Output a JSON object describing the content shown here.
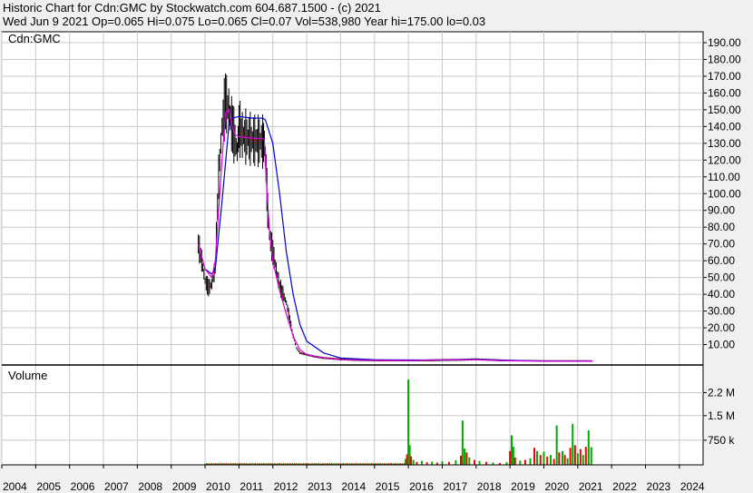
{
  "header": {
    "line1": "Historic Chart for Cdn:GMC by Stockwatch.com 604.687.1500 - (c) 2021",
    "line2": "Wed Jun  9 2021   Op=0.065  Hi=0.075   Lo=0.065   Cl=0.07   Vol=538,980   Year hi=175.00   lo=0.03"
  },
  "price_panel": {
    "label": "Cdn:GMC"
  },
  "volume_panel": {
    "label": "Volume"
  },
  "colors": {
    "background": "#ffffff",
    "page": "#f0f0f0",
    "grid": "#c8c8c8",
    "price_bars": "#000000",
    "down_marks": "#ff0000",
    "ma_long": "#0000cc",
    "ma_short": "#dd00dd",
    "volume_up": "#00aa00",
    "volume_down": "#ee0000"
  },
  "chart_data": [
    {
      "type": "line",
      "title": "Cdn:GMC",
      "ylim": [
        0,
        192
      ],
      "y_ticks": [
        "10.00",
        "20.00",
        "30.00",
        "40.00",
        "50.00",
        "60.00",
        "70.00",
        "80.00",
        "90.00",
        "100.00",
        "110.00",
        "120.00",
        "130.00",
        "140.00",
        "150.00",
        "160.00",
        "170.00",
        "180.00",
        "190.00"
      ],
      "grid": true,
      "series": [
        {
          "role": "price",
          "x": [
            2009.8,
            2009.9,
            2010.0,
            2010.1,
            2010.2,
            2010.3,
            2010.4,
            2010.5,
            2010.6,
            2010.7,
            2010.75,
            2010.85,
            2010.95,
            2011.0,
            2011.1,
            2011.4,
            2011.7,
            2011.75,
            2011.8,
            2011.85,
            2011.9,
            2012.0,
            2012.1,
            2012.2,
            2012.3,
            2012.4,
            2012.5,
            2012.6,
            2012.7,
            2012.8,
            2013.0,
            2013.2,
            2013.5,
            2014.0,
            2014.5,
            2015.0,
            2015.5,
            2016.0,
            2016.5,
            2017.0,
            2017.5,
            2018.0,
            2018.5,
            2019.0,
            2019.5,
            2020.0,
            2020.5,
            2021.0,
            2021.44
          ],
          "y": [
            70,
            60,
            48,
            44,
            46,
            56,
            110,
            140,
            155,
            150,
            145,
            135,
            125,
            140,
            135,
            132,
            131,
            130,
            115,
            90,
            75,
            65,
            55,
            45,
            40,
            35,
            25,
            15,
            8,
            5,
            4,
            3,
            2,
            1.2,
            0.8,
            0.6,
            0.5,
            0.4,
            0.5,
            0.8,
            0.9,
            1.2,
            0.8,
            0.3,
            0.2,
            0.1,
            0.1,
            0.1,
            0.07
          ]
        },
        {
          "role": "moving-average-long",
          "x": [
            2010.0,
            2010.2,
            2010.3,
            2010.5,
            2010.7,
            2010.8,
            2011.0,
            2011.4,
            2011.7,
            2011.78,
            2012.0,
            2012.2,
            2012.4,
            2012.6,
            2012.8,
            2013.0,
            2013.5,
            2014.0,
            2015.0,
            2016.0,
            2017.0,
            2018.0,
            2019.0,
            2020.0,
            2021.44
          ],
          "y": [
            55,
            52,
            55,
            95,
            140,
            145,
            146,
            145,
            145,
            144,
            130,
            100,
            65,
            40,
            22,
            12,
            5,
            2,
            1,
            0.8,
            0.8,
            1.2,
            0.6,
            0.2,
            0.1
          ]
        },
        {
          "role": "moving-average-short",
          "x": [
            2009.8,
            2010.0,
            2010.2,
            2010.3,
            2010.5,
            2010.6,
            2010.7,
            2010.8,
            2010.9,
            2011.0,
            2011.4,
            2011.7,
            2011.75,
            2011.8,
            2011.9,
            2012.0,
            2012.2,
            2012.4,
            2012.6,
            2012.8,
            2013.0,
            2013.5,
            2014.0,
            2015.0,
            2016.0,
            2017.0,
            2018.0,
            2019.0,
            2020.0,
            2021.44
          ],
          "y": [
            70,
            55,
            50,
            60,
            120,
            148,
            150,
            140,
            135,
            134,
            133,
            133,
            132,
            110,
            78,
            60,
            42,
            28,
            15,
            7,
            4,
            2,
            1,
            0.6,
            0.5,
            0.9,
            1.0,
            0.3,
            0.1,
            0.1
          ]
        }
      ]
    },
    {
      "type": "bar",
      "title": "Volume",
      "ylim": [
        0,
        2600000
      ],
      "y_ticks": [
        {
          "label": "750 k",
          "value": 750000
        },
        {
          "label": "1.5 M",
          "value": 1500000
        },
        {
          "label": "2.2 M",
          "value": 2200000
        }
      ],
      "grid": true,
      "bars": [
        {
          "x": 2015.92,
          "v": 180000,
          "up": true
        },
        {
          "x": 2015.96,
          "v": 320000,
          "up": false
        },
        {
          "x": 2016.0,
          "v": 2600000,
          "up": true
        },
        {
          "x": 2016.04,
          "v": 600000,
          "up": true
        },
        {
          "x": 2016.08,
          "v": 260000,
          "up": false
        },
        {
          "x": 2016.15,
          "v": 150000,
          "up": true
        },
        {
          "x": 2016.25,
          "v": 90000,
          "up": false
        },
        {
          "x": 2016.4,
          "v": 120000,
          "up": true
        },
        {
          "x": 2016.55,
          "v": 80000,
          "up": false
        },
        {
          "x": 2016.7,
          "v": 100000,
          "up": true
        },
        {
          "x": 2016.85,
          "v": 70000,
          "up": false
        },
        {
          "x": 2017.0,
          "v": 110000,
          "up": true
        },
        {
          "x": 2017.2,
          "v": 90000,
          "up": false
        },
        {
          "x": 2017.4,
          "v": 140000,
          "up": true
        },
        {
          "x": 2017.55,
          "v": 280000,
          "up": false
        },
        {
          "x": 2017.6,
          "v": 1350000,
          "up": true
        },
        {
          "x": 2017.66,
          "v": 500000,
          "up": true
        },
        {
          "x": 2017.72,
          "v": 380000,
          "up": false
        },
        {
          "x": 2017.8,
          "v": 230000,
          "up": true
        },
        {
          "x": 2017.95,
          "v": 150000,
          "up": false
        },
        {
          "x": 2018.1,
          "v": 120000,
          "up": true
        },
        {
          "x": 2018.3,
          "v": 90000,
          "up": false
        },
        {
          "x": 2018.5,
          "v": 70000,
          "up": true
        },
        {
          "x": 2018.7,
          "v": 60000,
          "up": false
        },
        {
          "x": 2018.9,
          "v": 80000,
          "up": true
        },
        {
          "x": 2019.0,
          "v": 420000,
          "up": false
        },
        {
          "x": 2019.05,
          "v": 900000,
          "up": true
        },
        {
          "x": 2019.1,
          "v": 550000,
          "up": true
        },
        {
          "x": 2019.15,
          "v": 220000,
          "up": false
        },
        {
          "x": 2019.3,
          "v": 130000,
          "up": true
        },
        {
          "x": 2019.45,
          "v": 150000,
          "up": false
        },
        {
          "x": 2019.6,
          "v": 200000,
          "up": true
        },
        {
          "x": 2019.72,
          "v": 520000,
          "up": false
        },
        {
          "x": 2019.8,
          "v": 420000,
          "up": true
        },
        {
          "x": 2019.9,
          "v": 300000,
          "up": false
        },
        {
          "x": 2020.0,
          "v": 400000,
          "up": true
        },
        {
          "x": 2020.1,
          "v": 250000,
          "up": false
        },
        {
          "x": 2020.2,
          "v": 300000,
          "up": true
        },
        {
          "x": 2020.3,
          "v": 180000,
          "up": false
        },
        {
          "x": 2020.38,
          "v": 1200000,
          "up": true
        },
        {
          "x": 2020.45,
          "v": 380000,
          "up": false
        },
        {
          "x": 2020.55,
          "v": 420000,
          "up": true
        },
        {
          "x": 2020.62,
          "v": 300000,
          "up": false
        },
        {
          "x": 2020.7,
          "v": 200000,
          "up": true
        },
        {
          "x": 2020.78,
          "v": 520000,
          "up": false
        },
        {
          "x": 2020.85,
          "v": 1250000,
          "up": true
        },
        {
          "x": 2020.92,
          "v": 600000,
          "up": false
        },
        {
          "x": 2021.0,
          "v": 350000,
          "up": true
        },
        {
          "x": 2021.08,
          "v": 480000,
          "up": false
        },
        {
          "x": 2021.16,
          "v": 300000,
          "up": true
        },
        {
          "x": 2021.24,
          "v": 550000,
          "up": false
        },
        {
          "x": 2021.32,
          "v": 1050000,
          "up": true
        },
        {
          "x": 2021.4,
          "v": 540000,
          "up": true
        }
      ]
    }
  ],
  "x_axis": {
    "xlim": [
      2004,
      2024.7
    ],
    "ticks": [
      "2004",
      "2005",
      "2006",
      "2007",
      "2008",
      "2009",
      "2010",
      "2011",
      "2012",
      "2013",
      "2014",
      "2015",
      "2016",
      "2017",
      "2018",
      "2019",
      "2020",
      "2021",
      "2022",
      "2023",
      "2024"
    ]
  }
}
